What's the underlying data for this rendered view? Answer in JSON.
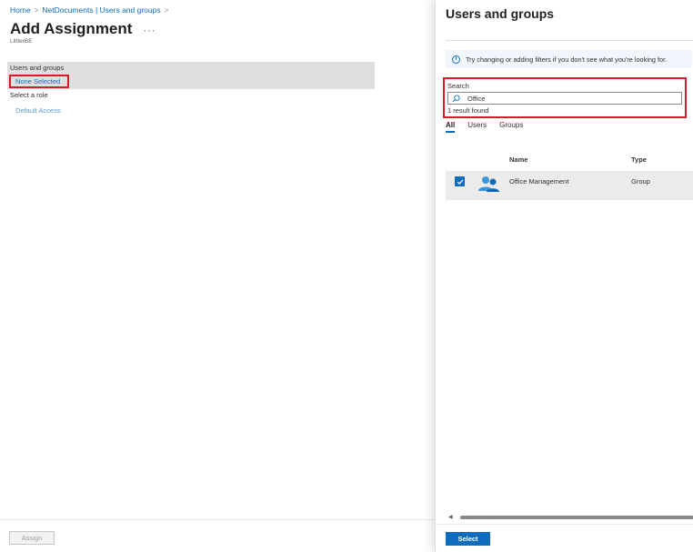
{
  "breadcrumb": {
    "home": "Home",
    "separator": ">",
    "parent": "NetDocuments | Users and groups"
  },
  "left": {
    "title": "Add Assignment",
    "more": "···",
    "subtitle": "LittlerBE",
    "users_groups_label": "Users and groups",
    "none_selected": "None Selected",
    "role_label": "Select a role",
    "role_value": "Default Access",
    "assign_label": "Assign"
  },
  "right": {
    "title": "Users and groups",
    "info_text": "Try changing or adding filters if you don't see what you're looking for.",
    "search_label": "Search",
    "search_value": "Office",
    "result_count": "1 result found",
    "tabs": [
      {
        "label": "All",
        "active": true
      },
      {
        "label": "Users",
        "active": false
      },
      {
        "label": "Groups",
        "active": false
      }
    ],
    "columns": {
      "name": "Name",
      "type": "Type"
    },
    "rows": [
      {
        "name": "Office Management",
        "type": "Group",
        "selected": true
      }
    ],
    "select_label": "Select"
  },
  "colors": {
    "accent": "#0f6cbd",
    "highlight_border": "#d21d28",
    "selected_row": "#edebe9"
  }
}
